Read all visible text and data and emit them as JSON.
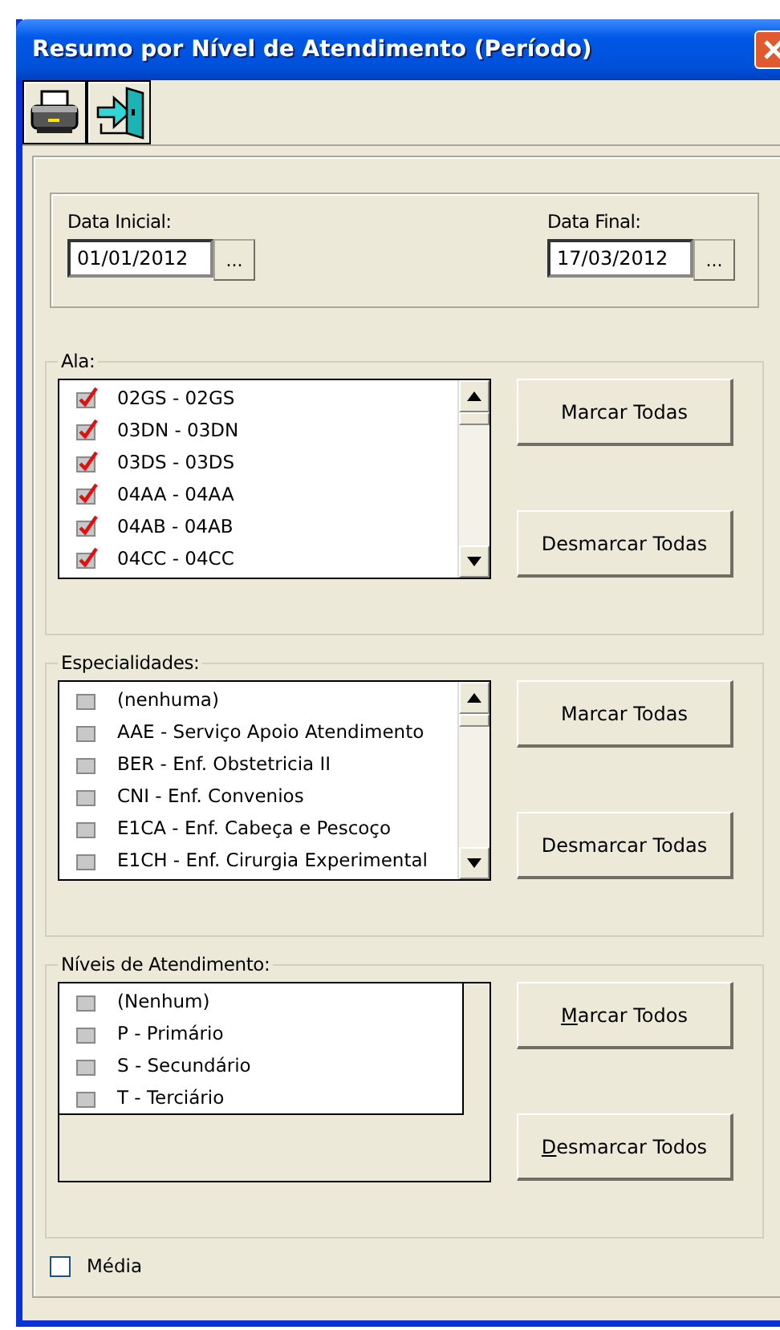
{
  "window": {
    "title": "Resumo por Nível de Atendimento (Período)"
  },
  "toolbar": [
    {
      "kind": "print"
    },
    {
      "kind": "exit"
    }
  ],
  "dates": [
    {
      "label": "Data Inicial:",
      "value": "01/01/2012",
      "button": "..."
    },
    {
      "label": "Data Final:",
      "value": "17/03/2012",
      "button": "..."
    }
  ],
  "groups": [
    {
      "label": "Ala:",
      "scrollbar": true,
      "items": [
        {
          "text": "02GS - 02GS",
          "checked": true
        },
        {
          "text": "03DN - 03DN",
          "checked": true
        },
        {
          "text": "03DS - 03DS",
          "checked": true
        },
        {
          "text": "04AA - 04AA",
          "checked": true
        },
        {
          "text": "04AB - 04AB",
          "checked": true
        },
        {
          "text": "04CC - 04CC",
          "checked": true
        }
      ],
      "buttons": [
        {
          "label": "Marcar Todas",
          "mnemonic": false
        },
        {
          "label": "Desmarcar Todas",
          "mnemonic": false
        }
      ]
    },
    {
      "label": "Especialidades:",
      "scrollbar": true,
      "items": [
        {
          "text": "(nenhuma)",
          "checked": false
        },
        {
          "text": "AAE - Serviço Apoio Atendimento",
          "checked": false
        },
        {
          "text": "BER - Enf. Obstetricia II",
          "checked": false
        },
        {
          "text": "CNI - Enf. Convenios",
          "checked": false
        },
        {
          "text": "E1CA - Enf. Cabeça e Pescoço",
          "checked": false
        },
        {
          "text": "E1CH - Enf. Cirurgia Experimental",
          "checked": false
        }
      ],
      "buttons": [
        {
          "label": "Marcar Todas",
          "mnemonic": false
        },
        {
          "label": "Desmarcar Todas",
          "mnemonic": false
        }
      ]
    },
    {
      "label": "Níveis de Atendimento:",
      "scrollbar": false,
      "items": [
        {
          "text": "(Nenhum)",
          "checked": false
        },
        {
          "text": "P - Primário",
          "checked": false
        },
        {
          "text": "S - Secundário",
          "checked": false
        },
        {
          "text": "T - Terciário",
          "checked": false
        }
      ],
      "buttons": [
        {
          "label": "Marcar Todos",
          "mnemonic": true
        },
        {
          "label": "Desmarcar Todos",
          "mnemonic": true
        }
      ]
    }
  ],
  "media": {
    "label": "Média",
    "checked": false
  }
}
